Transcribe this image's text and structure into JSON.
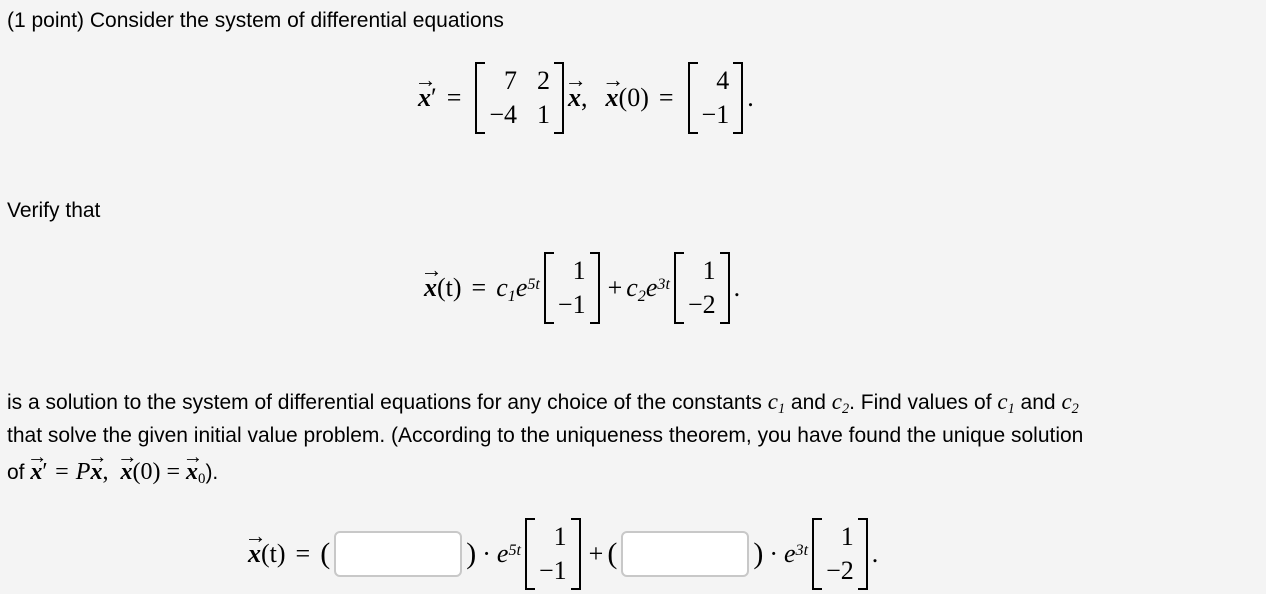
{
  "intro": "(1 point) Consider the system of differential equations",
  "system": {
    "lhs_var": "x",
    "prime": "′",
    "equals": "=",
    "matrix": [
      [
        "7",
        "2"
      ],
      [
        "−4",
        "1"
      ]
    ],
    "rhs_var": "x",
    "separator": ",",
    "ic_var": "x",
    "ic_arg": "(0)",
    "ic_vector": [
      "4",
      "−1"
    ],
    "end": "."
  },
  "verify_label": "Verify that",
  "general_solution": {
    "lhs": "x",
    "lhs_arg": "(t)",
    "equals": "=",
    "term1": {
      "const": "c",
      "const_sub": "1",
      "exp_base": "e",
      "exp": "5t",
      "vector": [
        "1",
        "−1"
      ]
    },
    "plus": "+",
    "term2": {
      "const": "c",
      "const_sub": "2",
      "exp_base": "e",
      "exp": "3t",
      "vector": [
        "1",
        "−2"
      ]
    },
    "end": "."
  },
  "paragraph": {
    "line1_a": "is a solution to the system of differential equations for any choice of the constants ",
    "c1": "c",
    "c1_sub": "1",
    "and": " and ",
    "c2": "c",
    "c2_sub": "2",
    "line1_b": ". Find values of ",
    "line2": "that solve the given initial value problem. (According to the uniqueness theorem, you have found the unique solution",
    "line3_prefix": "of ",
    "line3_math_x": "x",
    "line3_prime": "′",
    "line3_eq": " = P",
    "line3_x2": "x",
    "line3_comma": ",",
    "line3_x3": "x",
    "line3_arg": "(0) = ",
    "line3_x0": "x",
    "line3_x0_sub": "0",
    "line3_suffix": ")."
  },
  "answer": {
    "lhs": "x",
    "lhs_arg": "(t)",
    "equals": "=",
    "open_paren": "(",
    "close_paren": ")",
    "dot": "·",
    "exp_base": "e",
    "exp1": "5t",
    "exp2": "3t",
    "vector1": [
      "1",
      "−1"
    ],
    "vector2": [
      "1",
      "−2"
    ],
    "plus": "+",
    "end": ".",
    "c1_input": {
      "value": "",
      "placeholder": ""
    },
    "c2_input": {
      "value": "",
      "placeholder": ""
    }
  }
}
